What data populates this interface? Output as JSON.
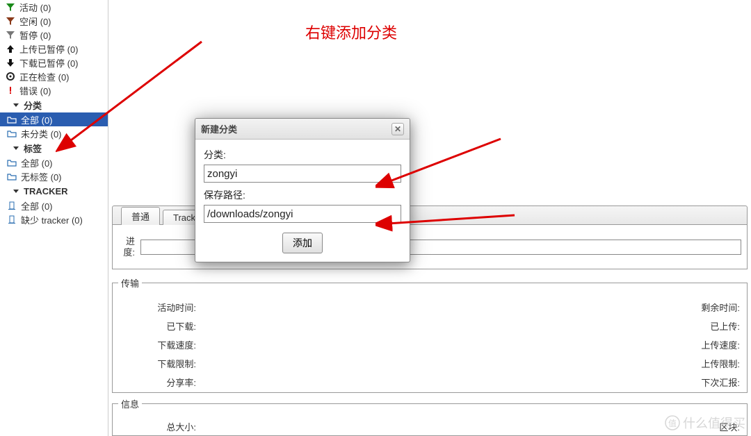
{
  "sidebar": {
    "status": [
      {
        "label": "活动 (0)"
      },
      {
        "label": "空闲 (0)"
      },
      {
        "label": "暂停 (0)"
      },
      {
        "label": "上传已暂停 (0)"
      },
      {
        "label": "下载已暂停 (0)"
      },
      {
        "label": "正在检查 (0)"
      },
      {
        "label": "错误 (0)"
      }
    ],
    "cat_header": "分类",
    "cat": [
      {
        "label": "全部 (0)",
        "selected": true
      },
      {
        "label": "未分类 (0)"
      }
    ],
    "tag_header": "标签",
    "tag": [
      {
        "label": "全部 (0)"
      },
      {
        "label": "无标签 (0)"
      }
    ],
    "tracker_header": "TRACKER",
    "tracker": [
      {
        "label": "全部 (0)"
      },
      {
        "label": "缺少 tracker (0)"
      }
    ]
  },
  "annotation": "右键添加分类",
  "tabs": {
    "general": "普通",
    "trackers": "Track"
  },
  "progress_label": "进度:",
  "transfer": {
    "legend": "传输",
    "active_time": "活动时间:",
    "downloaded": "已下载:",
    "dl_speed": "下载速度:",
    "dl_limit": "下载限制:",
    "ratio": "分享率:",
    "remaining": "剩余时间:",
    "uploaded": "已上传:",
    "up_speed": "上传速度:",
    "up_limit": "上传限制:",
    "next_report": "下次汇报:"
  },
  "info": {
    "legend": "信息",
    "total_size": "总大小:",
    "pieces": "区块:"
  },
  "dialog": {
    "title": "新建分类",
    "label_category": "分类:",
    "value_category": "zongyi",
    "label_path": "保存路径:",
    "value_path": "/downloads/zongyi",
    "add_btn": "添加"
  },
  "watermark": "什么值得买"
}
